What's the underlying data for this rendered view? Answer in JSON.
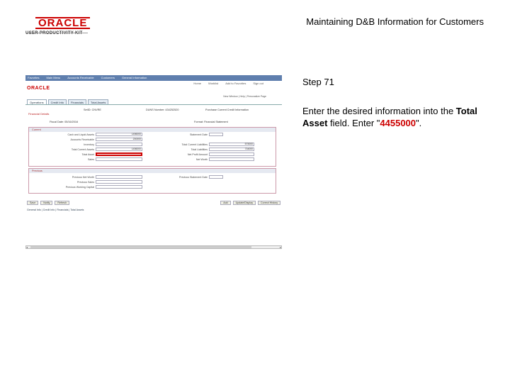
{
  "header": {
    "logo_word": "ORACLE",
    "logo_sub": "USER PRODUCTIVITY KIT",
    "title": "Maintaining D&B Information for Customers"
  },
  "instructions": {
    "step": "Step 71",
    "text_pre": "Enter the desired information into the ",
    "field": "Total Asset",
    "text_mid": " field. Enter \"",
    "value": "4455000",
    "text_post": "\"."
  },
  "screenshot": {
    "topbar": [
      "Favorites",
      "Main Menu",
      "Accounts Receivable",
      "Customers",
      "General Information"
    ],
    "subbar": [
      "Home",
      "Worklist",
      "Add to Favorites",
      "Sign out"
    ],
    "logo": "ORACLE",
    "personalize": "New Window | Help | Personalize Page",
    "tabs": [
      "Operations",
      "Credit Info",
      "Financials",
      "Total Assets"
    ],
    "hdr": {
      "setid": "SetID: CNVRE",
      "duns": "DUNS Number: 434252520",
      "extra": "Purchase Current Credit Information",
      "fiscal": "Fiscal Date: 05/16/2016",
      "format": "Format: Financial Statement"
    },
    "section_title": "Financial Details",
    "current": {
      "title": "Current",
      "rows": [
        {
          "label": "Cash and Liquid Assets",
          "value": "1456000"
        },
        {
          "label": "Accounts Receivable",
          "value": "230000"
        },
        {
          "label": "Inventory",
          "value": ""
        },
        {
          "label": "Total Current Assets",
          "value": "1456000"
        },
        {
          "label": "Total Asset",
          "value": ""
        },
        {
          "label": "Sales",
          "value": ""
        }
      ],
      "right_rows": [
        {
          "label": "Statement Date",
          "value": ""
        },
        {
          "label": "Total Current Liabilities",
          "value": "575000"
        },
        {
          "label": "Total Liabilities",
          "value": "734000"
        },
        {
          "label": "Net Profit Amount",
          "value": ""
        },
        {
          "label": "Net Worth",
          "value": ""
        }
      ]
    },
    "previous": {
      "title": "Previous",
      "rows": [
        {
          "label": "Previous Net Worth",
          "value": ""
        },
        {
          "label": "Previous Sales",
          "value": ""
        },
        {
          "label": "Previous Working Capital",
          "value": ""
        }
      ],
      "right_rows": [
        {
          "label": "Previous Statement Date",
          "value": ""
        }
      ]
    },
    "buttons_left": [
      "Save",
      "Notify",
      "Refresh"
    ],
    "buttons_right": [
      "Add",
      "Update/Display",
      "Correct History"
    ],
    "footer_links": "General Info | Credit Info | Financials | Total Assets"
  }
}
